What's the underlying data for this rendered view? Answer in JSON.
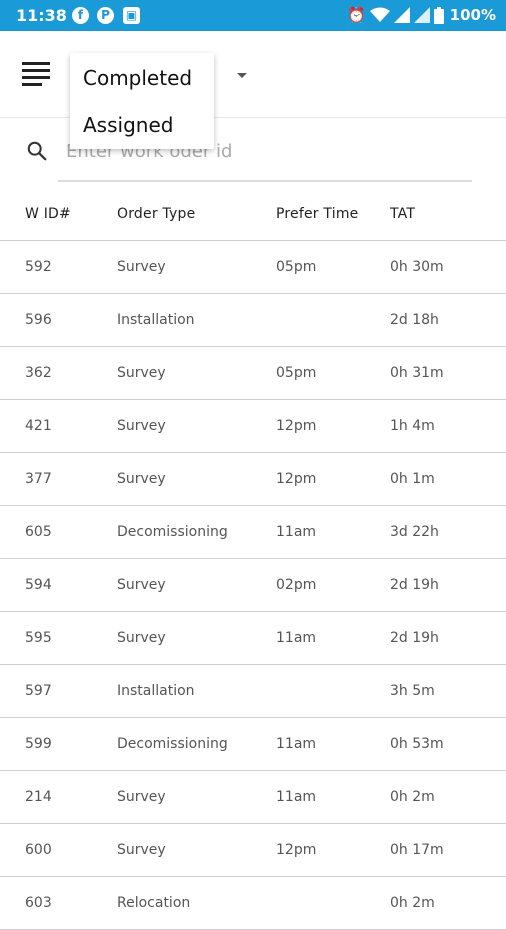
{
  "status_bar": {
    "time": "11:38",
    "battery": "100%",
    "icons": [
      "facebook-icon",
      "p-app-icon",
      "photo-app-icon",
      "alarm-icon",
      "wifi-icon",
      "signal-icon",
      "battery-icon"
    ]
  },
  "header": {
    "menu_icon": "menu-icon",
    "dropdown": {
      "items": [
        "Completed",
        "Assigned"
      ]
    }
  },
  "search": {
    "placeholder": "Enter work oder id",
    "value": ""
  },
  "table": {
    "headers": [
      "W ID#",
      "Order Type",
      "Prefer Time",
      "TAT"
    ],
    "rows": [
      [
        "592",
        "Survey",
        "05pm",
        "0h 30m"
      ],
      [
        "596",
        "Installation",
        "",
        "2d 18h"
      ],
      [
        "362",
        "Survey",
        "05pm",
        "0h 31m"
      ],
      [
        "421",
        "Survey",
        "12pm",
        "1h 4m"
      ],
      [
        "377",
        "Survey",
        "12pm",
        "0h 1m"
      ],
      [
        "605",
        "Decomissioning",
        "11am",
        "3d 22h"
      ],
      [
        "594",
        "Survey",
        "02pm",
        "2d 19h"
      ],
      [
        "595",
        "Survey",
        "11am",
        "2d 19h"
      ],
      [
        "597",
        "Installation",
        "",
        "3h 5m"
      ],
      [
        "599",
        "Decomissioning",
        "11am",
        "0h 53m"
      ],
      [
        "214",
        "Survey",
        "11am",
        "0h 2m"
      ],
      [
        "600",
        "Survey",
        "12pm",
        "0h 17m"
      ],
      [
        "603",
        "Relocation",
        "",
        "0h 2m"
      ]
    ]
  },
  "colors": {
    "status_bar": "#1a9ad6",
    "divider": "#cfcfcf"
  }
}
